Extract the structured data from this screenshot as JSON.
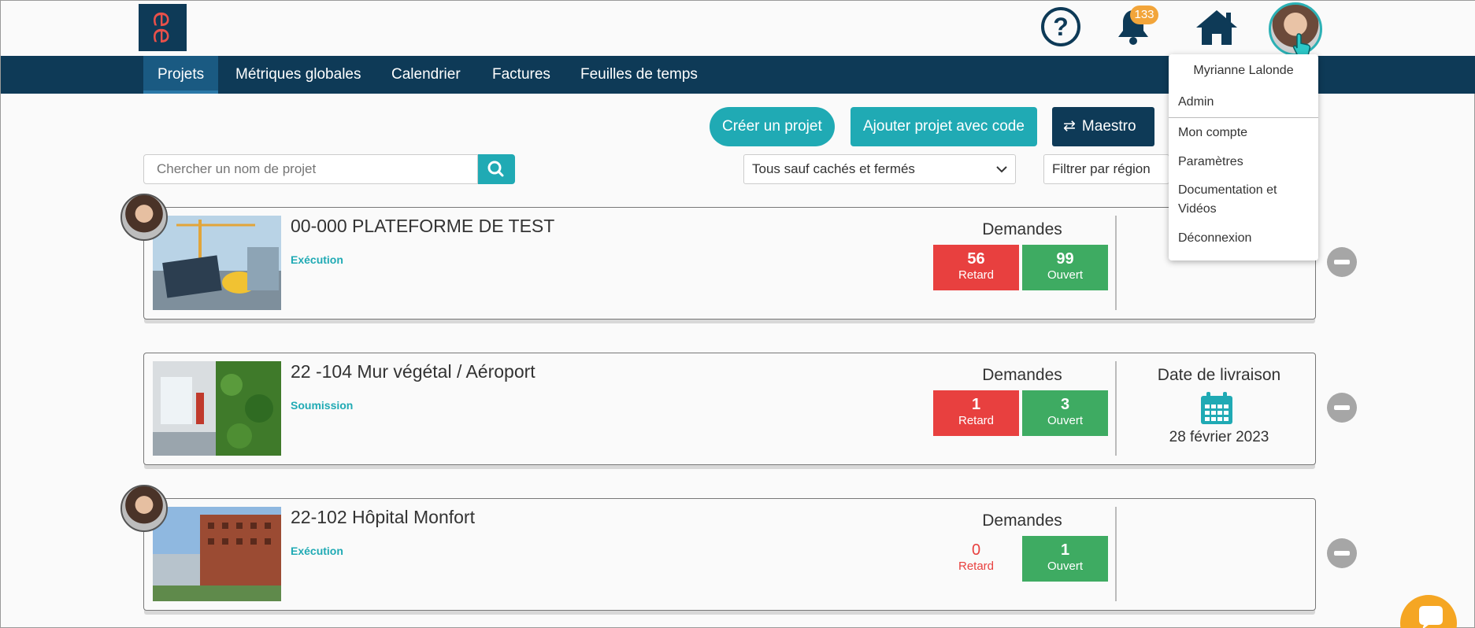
{
  "header": {
    "logo_text": "ee",
    "help_glyph": "?",
    "notification_count": "133",
    "colors": {
      "brand": "#0e3a57",
      "accent": "#20aab4",
      "logo_letters": "#e8504a",
      "badge": "#f2a53a"
    }
  },
  "nav": {
    "items": [
      {
        "label": "Projets",
        "active": true
      },
      {
        "label": "Métriques globales",
        "active": false
      },
      {
        "label": "Calendrier",
        "active": false
      },
      {
        "label": "Factures",
        "active": false
      },
      {
        "label": "Feuilles de temps",
        "active": false
      }
    ]
  },
  "actions": {
    "create_project": "Créer un projet",
    "add_project_code": "Ajouter projet avec code",
    "maestro": "Maestro",
    "swap_glyph": "⇄"
  },
  "search": {
    "placeholder": "Chercher un nom de projet",
    "filter_status": "Tous sauf cachés et fermés",
    "filter_region": "Filtrer par région"
  },
  "projects": [
    {
      "title": "00-000 PLATEFORME DE TEST",
      "phase": "Exécution",
      "requests_label": "Demandes",
      "late_count": "56",
      "late_label": "Retard",
      "open_count": "99",
      "open_label": "Ouvert"
    },
    {
      "title": "22 -104 Mur végétal / Aéroport",
      "phase": "Soumission",
      "requests_label": "Demandes",
      "late_count": "1",
      "late_label": "Retard",
      "open_count": "3",
      "open_label": "Ouvert",
      "delivery_label": "Date de livraison",
      "delivery_date": "28 février 2023"
    },
    {
      "title": "22-102 Hôpital Monfort",
      "phase": "Exécution",
      "requests_label": "Demandes",
      "late_count": "0",
      "late_label": "Retard",
      "open_count": "1",
      "open_label": "Ouvert"
    }
  ],
  "user_menu": {
    "name": "Myrianne Lalonde",
    "items": [
      "Admin",
      "Mon compte",
      "Paramètres",
      "Documentation et Vidéos",
      "Déconnexion"
    ]
  }
}
